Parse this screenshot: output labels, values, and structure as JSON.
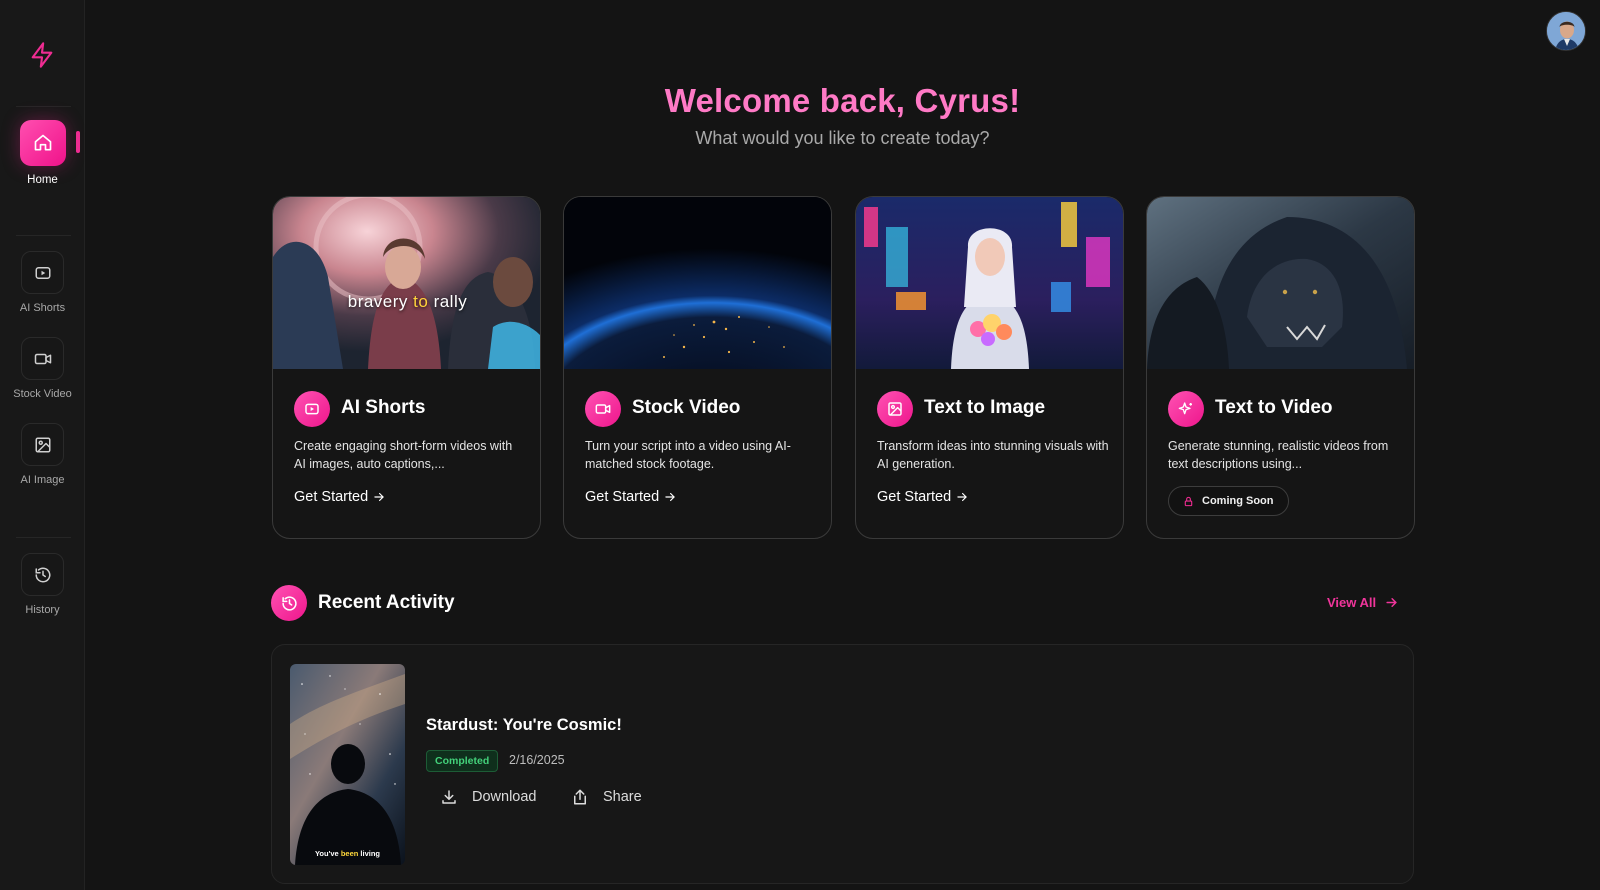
{
  "sidebar": {
    "logo_icon": "lightning-bolt-icon",
    "items": [
      {
        "label": "Home",
        "icon": "home-icon",
        "active": true
      },
      {
        "label": "AI Shorts",
        "icon": "video-play-icon"
      },
      {
        "label": "Stock Video",
        "icon": "video-camera-icon"
      },
      {
        "label": "AI Image",
        "icon": "image-icon"
      },
      {
        "label": "History",
        "icon": "history-icon"
      }
    ]
  },
  "header": {
    "welcome": "Welcome back, Cyrus!",
    "subtitle": "What would you like to create today?"
  },
  "cards": [
    {
      "title": "AI Shorts",
      "icon": "video-play-icon",
      "image_caption_parts": [
        "bravery ",
        "to",
        " rally"
      ],
      "description": "Create engaging short-form videos with AI images, auto captions,...",
      "cta": "Get Started"
    },
    {
      "title": "Stock Video",
      "icon": "video-camera-icon",
      "description": "Turn your script into a video using AI-matched stock footage.",
      "cta": "Get Started"
    },
    {
      "title": "Text to Image",
      "icon": "image-icon",
      "description": "Transform ideas into stunning visuals with AI generation.",
      "cta": "Get Started"
    },
    {
      "title": "Text to Video",
      "icon": "sparkles-icon",
      "description": "Generate stunning, realistic videos from text descriptions using...",
      "badge": "Coming Soon"
    }
  ],
  "recent": {
    "title": "Recent Activity",
    "view_all": "View All",
    "items": [
      {
        "title": "Stardust: You're Cosmic!",
        "status": "Completed",
        "date": "2/16/2025",
        "thumb_caption_parts": [
          "You've ",
          "been",
          " living"
        ],
        "download": "Download",
        "share": "Share"
      }
    ]
  },
  "colors": {
    "accent": "#ef2c92",
    "accent_light": "#ff7ac6",
    "background": "#141414",
    "status_completed": "#43d17a"
  }
}
